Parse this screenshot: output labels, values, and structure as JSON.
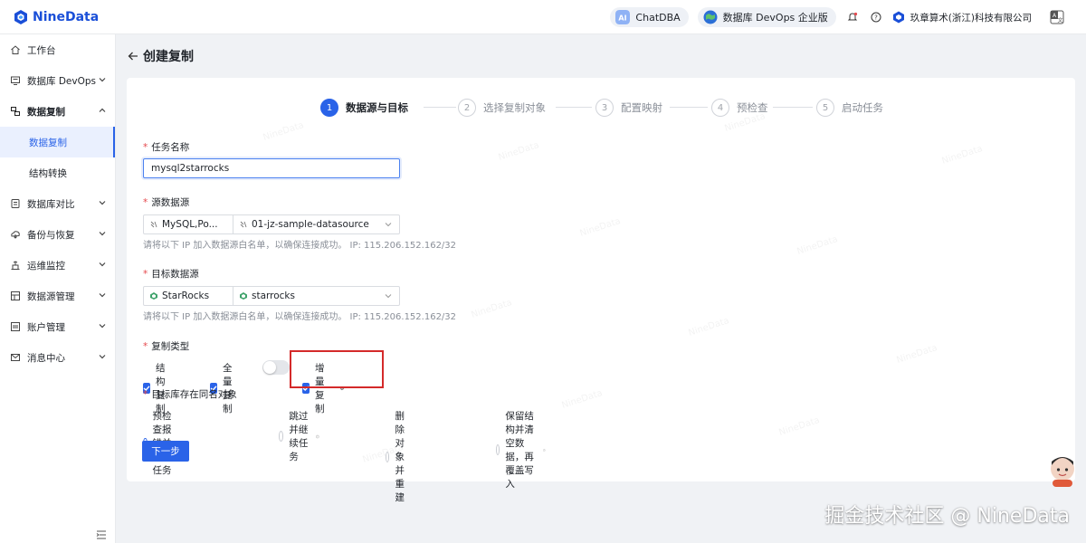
{
  "app": {
    "brand_name": "NineData",
    "chatdba_label": "ChatDBA",
    "edition_label": "数据库 DevOps 企业版",
    "company_name": "玖章算术(浙江)科技有限公司"
  },
  "sidebar": {
    "items": [
      {
        "label": "工作台",
        "icon": "home-icon"
      },
      {
        "label": "数据库 DevOps",
        "icon": "monitor-icon"
      },
      {
        "label": "数据复制",
        "icon": "replicate-icon"
      },
      {
        "label": "数据复制"
      },
      {
        "label": "结构转换"
      },
      {
        "label": "数据库对比",
        "icon": "compare-icon"
      },
      {
        "label": "备份与恢复",
        "icon": "backup-icon"
      },
      {
        "label": "运维监控",
        "icon": "ops-icon"
      },
      {
        "label": "数据源管理",
        "icon": "datasource-icon"
      },
      {
        "label": "账户管理",
        "icon": "account-icon"
      },
      {
        "label": "消息中心",
        "icon": "mail-icon"
      }
    ]
  },
  "page": {
    "title": "创建复制"
  },
  "steps": [
    {
      "num": "1",
      "label": "数据源与目标"
    },
    {
      "num": "2",
      "label": "选择复制对象"
    },
    {
      "num": "3",
      "label": "配置映射"
    },
    {
      "num": "4",
      "label": "预检查"
    },
    {
      "num": "5",
      "label": "启动任务"
    }
  ],
  "form": {
    "task_name_label": "任务名称",
    "task_name_value": "mysql2starrocks",
    "source_label": "源数据源",
    "source_type": "MySQL,Po...",
    "source_name": "01-jz-sample-datasource",
    "source_hint": "请将以下 IP 加入数据源白名单，以确保连接成功。 IP: 115.206.152.162/32",
    "target_label": "目标数据源",
    "target_type": "StarRocks",
    "target_name": "starrocks",
    "target_hint": "请将以下 IP 加入数据源白名单，以确保连接成功。 IP: 115.206.152.162/32",
    "copy_type_label": "复制类型",
    "copy_types": [
      "结构复制",
      "全量复制",
      "增量复制"
    ],
    "conflict_label": "目标库存在同名对象",
    "conflict_options": [
      "预检查报错并停止任务",
      "跳过并继续任务",
      "删除对象并重建",
      "保留结构并清空数据，再覆盖写入"
    ],
    "conflict_selected": 0,
    "next_button": "下一步"
  },
  "watermark": "NineData",
  "footer_text": "掘金技术社区 @ NineData",
  "colors": {
    "accent": "#2a63e8",
    "brand": "#1a4fd8",
    "required": "#e5484d",
    "highlight_box": "#d42a2a"
  }
}
